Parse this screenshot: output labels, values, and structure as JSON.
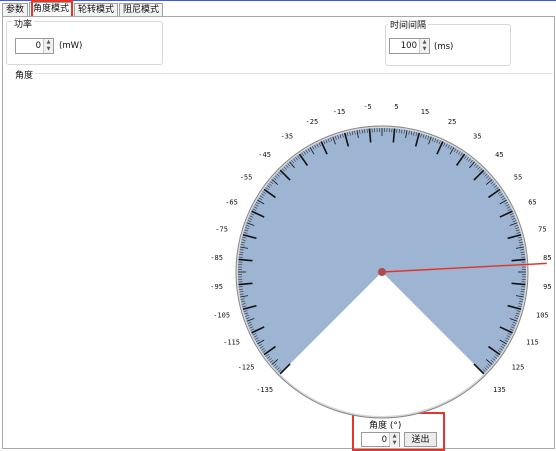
{
  "tabs": [
    {
      "label": "参数"
    },
    {
      "label": "角度模式"
    },
    {
      "label": "轮转模式"
    },
    {
      "label": "阻尼模式"
    }
  ],
  "power": {
    "label": "功率",
    "value": "0",
    "unit": "(mW)"
  },
  "interval": {
    "label": "时间间隔",
    "value": "100",
    "unit": "(ms)"
  },
  "angle_group": {
    "label": "角度"
  },
  "dial": {
    "scale_min": -135,
    "scale_max": 135,
    "label_step": 10,
    "labels": [
      "-135",
      "-125",
      "-115",
      "-105",
      "-95",
      "-85",
      "-75",
      "-65",
      "-55",
      "-45",
      "-35",
      "-25",
      "-15",
      "-5",
      "5",
      "15",
      "25",
      "35",
      "45",
      "55",
      "65",
      "75",
      "85",
      "95",
      "105",
      "115",
      "125",
      "135"
    ],
    "needle_angle": 87,
    "face_color": "#9db5d3",
    "needle_color": "#e0342b",
    "hub_color": "#b04b4b"
  },
  "angle_input": {
    "label": "角度 (°)",
    "value": "0",
    "button": "送出"
  },
  "highlight_color": "#e5342b"
}
